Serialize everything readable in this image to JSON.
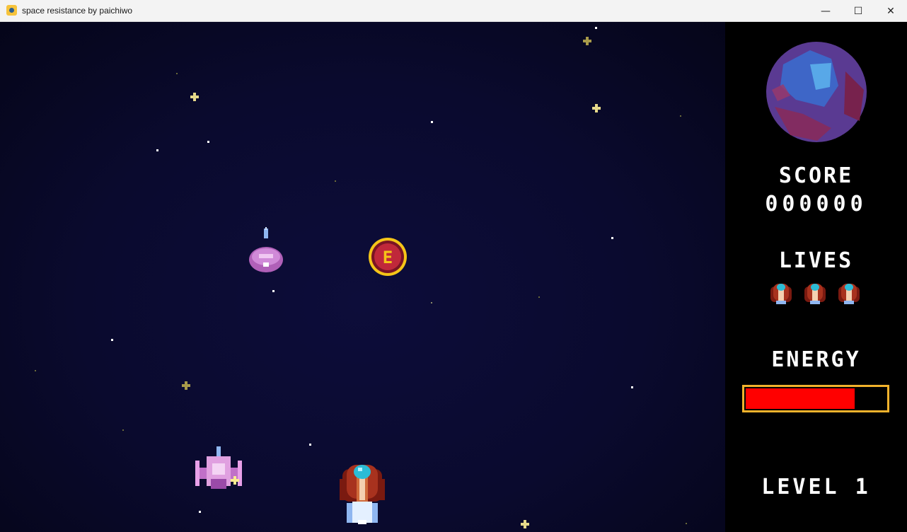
{
  "window": {
    "title": "space resistance by paichiwo",
    "app_icon": "pygame-snake-icon",
    "controls": {
      "minimize": "—",
      "maximize": "☐",
      "close": "✕"
    }
  },
  "hud": {
    "score_label": "SCORE",
    "score_value": "000000",
    "lives_label": "LIVES",
    "lives_count": 3,
    "energy_label": "ENERGY",
    "energy_fraction": 0.78,
    "level_label": "LEVEL 1"
  },
  "game": {
    "powerup_letter": "E",
    "colors": {
      "space": "#0a0a2e",
      "energy_fill": "#ff0000",
      "energy_border": "#f2b22c",
      "powerup_gold": "#f5c518",
      "powerup_red": "#c0283a",
      "player_red": "#a8321e",
      "enemy_pink": "#c98ad8"
    }
  }
}
